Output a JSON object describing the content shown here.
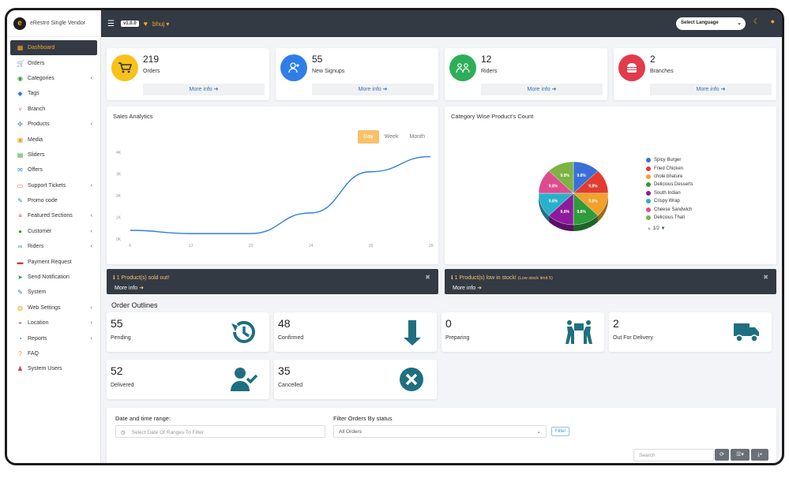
{
  "app": {
    "name": "eRestro Single Vendor"
  },
  "topbar": {
    "version": "v1.0.0",
    "location": "bhuj",
    "language_select": "Select Language"
  },
  "sidebar": {
    "items": [
      {
        "label": "Dashboard",
        "icon": "dashboard-icon",
        "active": true,
        "submenu": false
      },
      {
        "label": "Orders",
        "icon": "cart-icon",
        "submenu": false
      },
      {
        "label": "Categories",
        "icon": "categories-icon",
        "submenu": true
      },
      {
        "label": "Tags",
        "icon": "tag-icon",
        "submenu": false
      },
      {
        "label": "Branch",
        "icon": "branch-icon",
        "submenu": false
      },
      {
        "label": "Products",
        "icon": "products-icon",
        "submenu": true
      },
      {
        "label": "Media",
        "icon": "media-icon",
        "submenu": false
      },
      {
        "label": "Sliders",
        "icon": "slider-icon",
        "submenu": false
      },
      {
        "label": "Offers",
        "icon": "offers-icon",
        "submenu": false
      },
      {
        "label": "Support Tickets",
        "icon": "ticket-icon",
        "submenu": true
      },
      {
        "label": "Promo code",
        "icon": "promo-icon",
        "submenu": false
      },
      {
        "label": "Featured Sections",
        "icon": "layers-icon",
        "submenu": true
      },
      {
        "label": "Customer",
        "icon": "customer-icon",
        "submenu": true
      },
      {
        "label": "Riders",
        "icon": "riders-icon",
        "submenu": true
      },
      {
        "label": "Payment Request",
        "icon": "money-icon",
        "submenu": false
      },
      {
        "label": "Send Notification",
        "icon": "send-icon",
        "submenu": false
      },
      {
        "label": "System",
        "icon": "wrench-icon",
        "submenu": false
      },
      {
        "label": "Web Settings",
        "icon": "globe-icon",
        "submenu": true
      },
      {
        "label": "Location",
        "icon": "location-icon",
        "submenu": true
      },
      {
        "label": "Reports",
        "icon": "reports-icon",
        "submenu": true
      },
      {
        "label": "FAQ",
        "icon": "question-icon",
        "submenu": false
      },
      {
        "label": "System Users",
        "icon": "users-icon",
        "submenu": false
      }
    ]
  },
  "stats": [
    {
      "value": "219",
      "label": "Orders",
      "more": "More info",
      "color": "#f7c21c",
      "icon": "cart-icon"
    },
    {
      "value": "55",
      "label": "New Signups",
      "more": "More info",
      "color": "#2f7ee8",
      "icon": "user-plus-icon"
    },
    {
      "value": "12",
      "label": "Riders",
      "more": "More info",
      "color": "#2fae5a",
      "icon": "riders-icon"
    },
    {
      "value": "2",
      "label": "Branches",
      "more": "More info",
      "color": "#e23b4b",
      "icon": "branch-icon"
    }
  ],
  "sales": {
    "title": "Sales Analytics",
    "tabs": [
      "Day",
      "Week",
      "Month"
    ],
    "active_tab": "Day"
  },
  "category_chart": {
    "title": "Category Wise Product's Count",
    "pager": "1/2"
  },
  "chart_data": [
    {
      "type": "line",
      "x": [
        "4",
        "12",
        "23",
        "24",
        "25",
        "26"
      ],
      "y_ticks": [
        "0K",
        "1K",
        "2K",
        "3K",
        "4K"
      ],
      "ylim": [
        0,
        4000
      ],
      "values": [
        400,
        250,
        250,
        1200,
        3100,
        3800
      ],
      "color": "#2f7ee8",
      "grid": false
    },
    {
      "type": "pie",
      "categories": [
        "Spicy Burger",
        "Fried Chicken",
        "chole bhature",
        "Delicious Desserts",
        "South Indian",
        "Crispy Wrap",
        "Cheese Sandwich",
        "Delicious Thali"
      ],
      "slice_label": "9.8%",
      "values": [
        9.8,
        9.8,
        9.8,
        9.8,
        9.8,
        9.8,
        9.8,
        9.8
      ],
      "colors": [
        "#3a6fd8",
        "#e23b2f",
        "#f2a12a",
        "#2e9b3c",
        "#8e1a9e",
        "#29b0c9",
        "#de4b8e",
        "#7cb342"
      ],
      "legend": "right"
    }
  ],
  "alerts": [
    {
      "title": "1 Product(s) sold out!",
      "note": "",
      "more": "More info"
    },
    {
      "title": "1 Product(s) low in stock!",
      "note": "(Low stock limit 5)",
      "more": "More info"
    }
  ],
  "order_outlines": {
    "heading": "Order Outlines",
    "cards": [
      {
        "value": "55",
        "label": "Pending",
        "icon": "history-icon"
      },
      {
        "value": "48",
        "label": "Confirmed",
        "icon": "arrow-down-icon"
      },
      {
        "value": "0",
        "label": "Preparing",
        "icon": "people-carry-icon"
      },
      {
        "value": "2",
        "label": "Out For Delivery",
        "icon": "truck-icon"
      },
      {
        "value": "52",
        "label": "Delivered",
        "icon": "user-check-icon"
      },
      {
        "value": "35",
        "label": "Cancelled",
        "icon": "times-circle-icon"
      }
    ]
  },
  "filters": {
    "date_label": "Date and time range:",
    "date_placeholder": "Select Date Of Ranges To Filter",
    "status_label": "Filter Orders By status",
    "status_value": "All Orders",
    "filter_button": "Filter",
    "search_placeholder": "Search"
  }
}
